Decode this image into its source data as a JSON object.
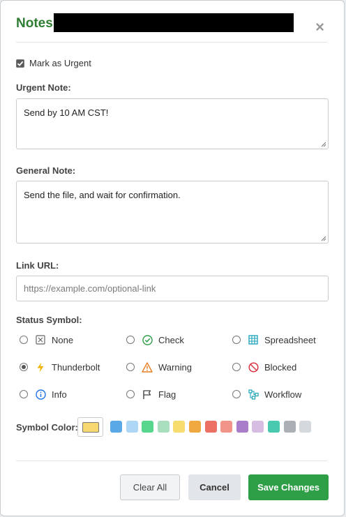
{
  "header": {
    "title_label": "Notes:",
    "close_glyph": "×"
  },
  "urgent": {
    "checkbox_label": "Mark as Urgent",
    "checked": true
  },
  "urgent_note": {
    "label": "Urgent Note:",
    "value": "Send by 10 AM CST!"
  },
  "general_note": {
    "label": "General Note:",
    "value": "Send the file, and wait for confirmation."
  },
  "link": {
    "label": "Link URL:",
    "placeholder": "https://example.com/optional-link"
  },
  "status": {
    "label": "Status Symbol:",
    "selected": "Thunderbolt",
    "options": [
      {
        "label": "None",
        "icon": "none-x-icon",
        "color": "#666666"
      },
      {
        "label": "Check",
        "icon": "check-circle-icon",
        "color": "#2e9e47"
      },
      {
        "label": "Spreadsheet",
        "icon": "spreadsheet-icon",
        "color": "#17a2b8"
      },
      {
        "label": "Thunderbolt",
        "icon": "thunderbolt-icon",
        "color": "#f0b400"
      },
      {
        "label": "Warning",
        "icon": "warning-icon",
        "color": "#e67e22"
      },
      {
        "label": "Blocked",
        "icon": "blocked-icon",
        "color": "#dc3545"
      },
      {
        "label": "Info",
        "icon": "info-icon",
        "color": "#1e73e8"
      },
      {
        "label": "Flag",
        "icon": "flag-icon",
        "color": "#444444"
      },
      {
        "label": "Workflow",
        "icon": "workflow-icon",
        "color": "#17a2b8"
      }
    ]
  },
  "symbol_color": {
    "label": "Symbol Color:",
    "selected": "#f7d870",
    "swatches": [
      "#5aa9e6",
      "#aed6f5",
      "#58d68d",
      "#a9dfbf",
      "#f7dc6f",
      "#f0a940",
      "#ec7063",
      "#f1948a",
      "#a97dc9",
      "#d7bde2",
      "#48c9b0",
      "#aab0b6",
      "#d5d8dc"
    ]
  },
  "footer": {
    "clear_label": "Clear All",
    "cancel_label": "Cancel",
    "save_label": "Save Changes"
  }
}
